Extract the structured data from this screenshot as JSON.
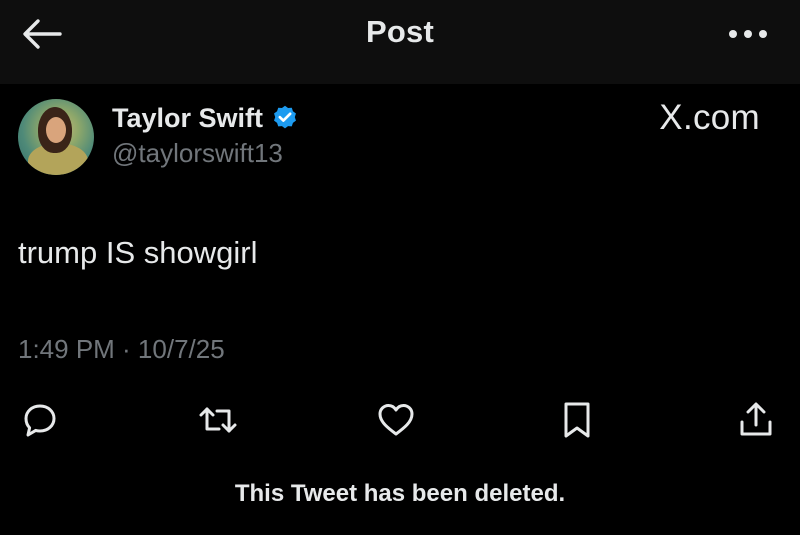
{
  "header": {
    "title": "Post",
    "back_icon": "arrow-left-icon",
    "more_icon": "more-horizontal-icon"
  },
  "tweet": {
    "author": {
      "display_name": "Taylor Swift",
      "handle": "@taylorswift13",
      "verified": true,
      "verified_color": "#1d9bf0"
    },
    "site_label": "X.com",
    "text": "trump IS showgirl",
    "timestamp": "1:49 PM · 10/7/25"
  },
  "actions": [
    {
      "name": "reply",
      "icon": "reply-icon"
    },
    {
      "name": "repost",
      "icon": "repost-icon"
    },
    {
      "name": "like",
      "icon": "heart-icon"
    },
    {
      "name": "bookmark",
      "icon": "bookmark-icon"
    },
    {
      "name": "share",
      "icon": "share-icon"
    }
  ],
  "footer": {
    "note": "This Tweet has been deleted."
  },
  "colors": {
    "background": "#000000",
    "header_background": "#0e0e0e",
    "primary_text": "#e7e9ea",
    "secondary_text": "#71767b",
    "accent": "#1d9bf0"
  }
}
